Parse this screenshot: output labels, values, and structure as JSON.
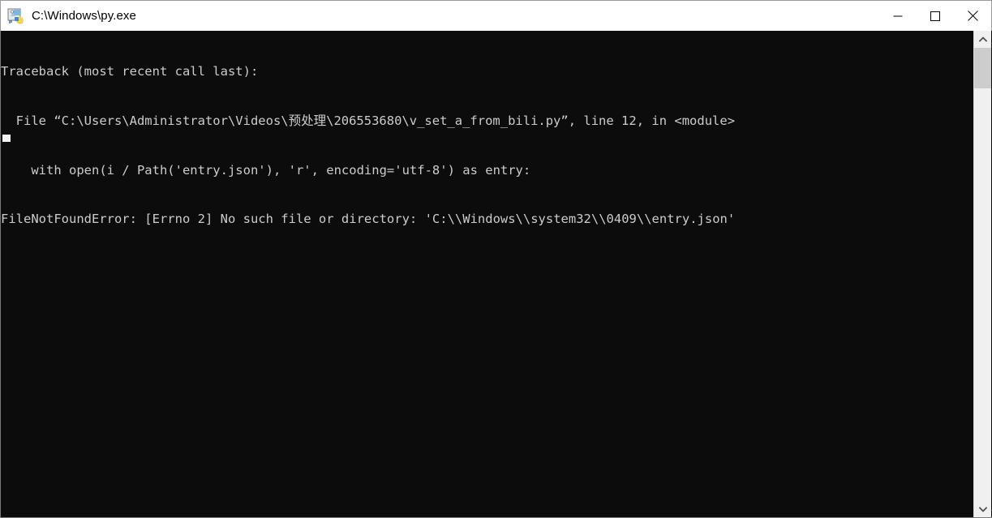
{
  "window": {
    "title": "C:\\Windows\\py.exe",
    "icon": "python-launcher-icon",
    "background_color": "#0c0c0c",
    "titlebar_color": "#ffffff",
    "text_color": "#cccccc"
  },
  "titlebar_buttons": {
    "minimize_label": "—",
    "maximize_label": "□",
    "close_label": "✕"
  },
  "console": {
    "lines": [
      "Traceback (most recent call last):",
      "  File “C:\\Users\\Administrator\\Videos\\预处理\\206553680\\v_set_a_from_bili.py”, line 12, in <module>",
      "    with open(i / Path('entry.json'), 'r', encoding='utf-8') as entry:",
      "FileNotFoundError: [Errno 2] No such file or directory: 'C:\\\\Windows\\\\system32\\\\0409\\\\entry.json'"
    ],
    "cursor_visible": true
  },
  "scrollbar": {
    "up_arrow": "▲",
    "down_arrow": "▼",
    "thumb_position_percent": 0,
    "visible": true
  }
}
